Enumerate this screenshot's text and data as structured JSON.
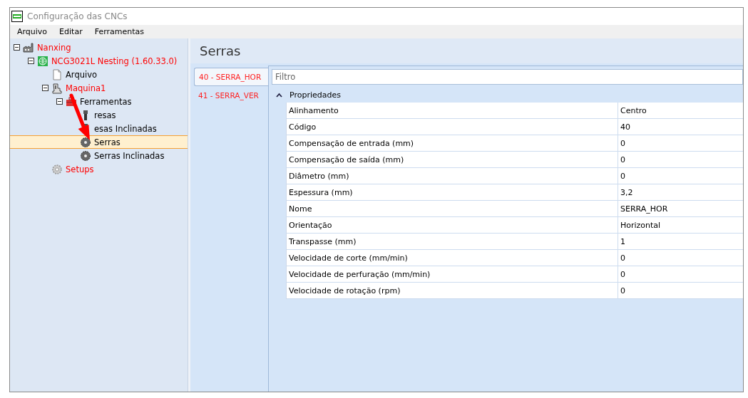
{
  "window": {
    "title": "Configuração das CNCs"
  },
  "menu": [
    "Arquivo",
    "Editar",
    "Ferramentas"
  ],
  "tree": [
    {
      "label": "Nanxing",
      "kind": "factory",
      "color": "#ff0000",
      "expanded": true,
      "selected": false,
      "children": [
        {
          "label": "NCG3021L Nesting (1.60.33.0)",
          "kind": "machine",
          "color": "#ff0000",
          "expanded": true,
          "selected": false,
          "children": [
            {
              "label": "Arquivo",
              "kind": "document",
              "color": "#000000",
              "selected": false
            },
            {
              "label": "Maquina1",
              "kind": "press",
              "color": "#ff0000",
              "expanded": true,
              "selected": false,
              "children": [
                {
                  "label": "Ferramentas",
                  "kind": "toolbox",
                  "color": "#000000",
                  "expanded": true,
                  "selected": false,
                  "children": [
                    {
                      "label": "resas",
                      "kind": "mill",
                      "color": "#000000",
                      "selected": false
                    },
                    {
                      "label": "esas Inclinadas",
                      "kind": "mill",
                      "color": "#000000",
                      "selected": false
                    },
                    {
                      "label": "Serras",
                      "kind": "saw",
                      "color": "#000000",
                      "selected": true
                    },
                    {
                      "label": "Serras Inclinadas",
                      "kind": "saw",
                      "color": "#000000",
                      "selected": false
                    }
                  ]
                }
              ]
            },
            {
              "label": "Setups",
              "kind": "gear",
              "color": "#ff0000",
              "selected": false
            }
          ]
        }
      ]
    }
  ],
  "panel": {
    "title": "Serras",
    "tabs": [
      {
        "label": "40 - SERRA_HOR",
        "selected": true
      },
      {
        "label": "41 - SERRA_VER",
        "selected": false
      }
    ],
    "filter": {
      "placeholder": "Filtro"
    },
    "group": {
      "label": "Propriedades",
      "expanded": true
    },
    "properties": [
      {
        "name": "Alinhamento",
        "value": "Centro"
      },
      {
        "name": "Código",
        "value": "40"
      },
      {
        "name": "Compensação de entrada (mm)",
        "value": "0"
      },
      {
        "name": "Compensação de saída (mm)",
        "value": "0"
      },
      {
        "name": "Diâmetro (mm)",
        "value": "0"
      },
      {
        "name": "Espessura (mm)",
        "value": "3,2"
      },
      {
        "name": "Nome",
        "value": "SERRA_HOR"
      },
      {
        "name": "Orientação",
        "value": "Horizontal"
      },
      {
        "name": "Transpasse (mm)",
        "value": "1"
      },
      {
        "name": "Velocidade de corte (mm/min)",
        "value": "0"
      },
      {
        "name": "Velocidade de perfuração (mm/min)",
        "value": "0"
      },
      {
        "name": "Velocidade de rotação (rpm)",
        "value": "0"
      }
    ]
  }
}
